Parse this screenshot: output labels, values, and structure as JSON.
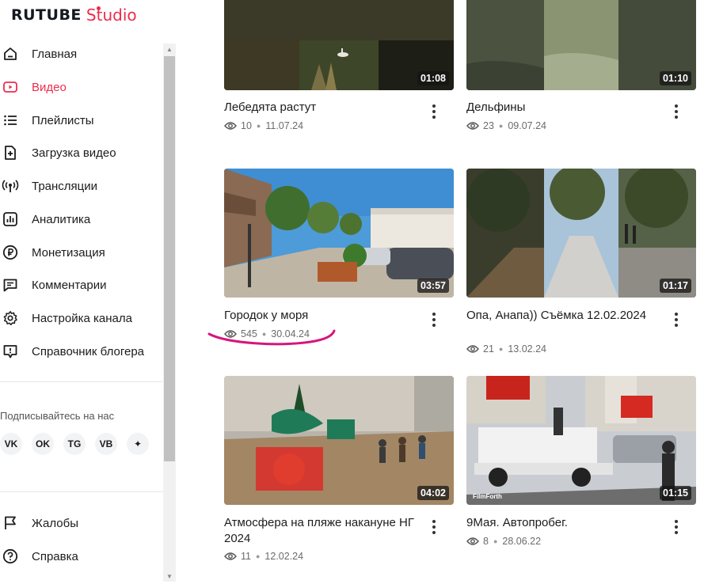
{
  "logo": {
    "brand": "RUTUBE",
    "product": "Studio"
  },
  "sidebar": {
    "items": [
      {
        "label": "Главная",
        "icon": "home-icon",
        "active": false
      },
      {
        "label": "Видео",
        "icon": "video-icon",
        "active": true
      },
      {
        "label": "Плейлисты",
        "icon": "playlist-icon",
        "active": false
      },
      {
        "label": "Загрузка видео",
        "icon": "upload-file-icon",
        "active": false
      },
      {
        "label": "Трансляции",
        "icon": "broadcast-icon",
        "active": false
      },
      {
        "label": "Аналитика",
        "icon": "analytics-icon",
        "active": false
      },
      {
        "label": "Монетизация",
        "icon": "ruble-icon",
        "active": false
      },
      {
        "label": "Комментарии",
        "icon": "comment-icon",
        "active": false
      },
      {
        "label": "Настройка канала",
        "icon": "gear-icon",
        "active": false
      },
      {
        "label": "Справочник блогера",
        "icon": "info-bubble-icon",
        "active": false
      }
    ],
    "social_title": "Подписывайтесь на нас",
    "socials": [
      {
        "label": "VK",
        "icon": "vk-icon"
      },
      {
        "label": "OK",
        "icon": "odnoklassniki-icon"
      },
      {
        "label": "TG",
        "icon": "telegram-icon"
      },
      {
        "label": "VB",
        "icon": "viber-icon"
      },
      {
        "label": "✦",
        "icon": "sparkle-icon"
      }
    ],
    "bottom_items": [
      {
        "label": "Жалобы",
        "icon": "flag-icon"
      },
      {
        "label": "Справка",
        "icon": "help-icon"
      }
    ]
  },
  "videos": [
    {
      "title": "Лебедята растут",
      "views": "10",
      "date": "11.07.24",
      "duration": "01:08"
    },
    {
      "title": "Дельфины",
      "views": "23",
      "date": "09.07.24",
      "duration": "01:10"
    },
    {
      "title": "Городок у моря",
      "views": "545",
      "date": "30.04.24",
      "duration": "03:57"
    },
    {
      "title": "Опа, Анапа)) Съёмка 12.02.2024",
      "views": "21",
      "date": "13.02.24",
      "duration": "01:17"
    },
    {
      "title": "Атмосфера на пляже накануне НГ 2024",
      "views": "11",
      "date": "12.02.24",
      "duration": "04:02"
    },
    {
      "title": "9Мая. Автопробег.",
      "views": "8",
      "date": "28.06.22",
      "duration": "01:15",
      "watermark": "FilmForth"
    }
  ],
  "colors": {
    "accent": "#ee2c4d",
    "annotation": "#d6157d"
  }
}
